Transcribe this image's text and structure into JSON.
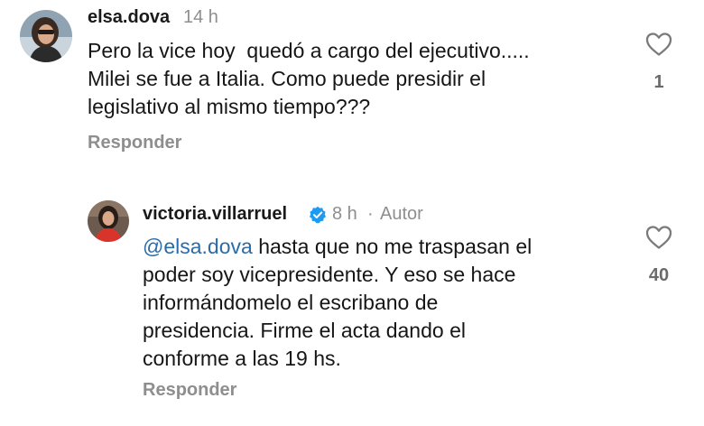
{
  "comments": [
    {
      "username": "elsa.dova",
      "time": "14 h",
      "text": "Pero la vice hoy  quedó a cargo del ejecutivo.....\nMilei se fue a Italia. Como puede presidir el\nlegislativo al mismo tiempo???",
      "likes": "1",
      "reply_label": "Responder",
      "avatar_icon": "user-avatar"
    },
    {
      "username": "victoria.villarruel",
      "verified": true,
      "verified_icon": "verified-badge-icon",
      "time": "8 h",
      "separator": "·",
      "author_badge": "Autor",
      "mention": "@elsa.dova",
      "text": " hasta que no me traspasan el\npoder soy vicepresidente. Y eso se hace\ninformándomelo el escribano de\npresidencia. Firme el acta dando el\nconforme a las 19 hs.",
      "likes": "40",
      "reply_label": "Responder",
      "avatar_icon": "user-avatar"
    }
  ],
  "colors": {
    "verified": "#1d9bf0",
    "mention": "#2b6ba8",
    "muted": "#8e8e8e"
  }
}
